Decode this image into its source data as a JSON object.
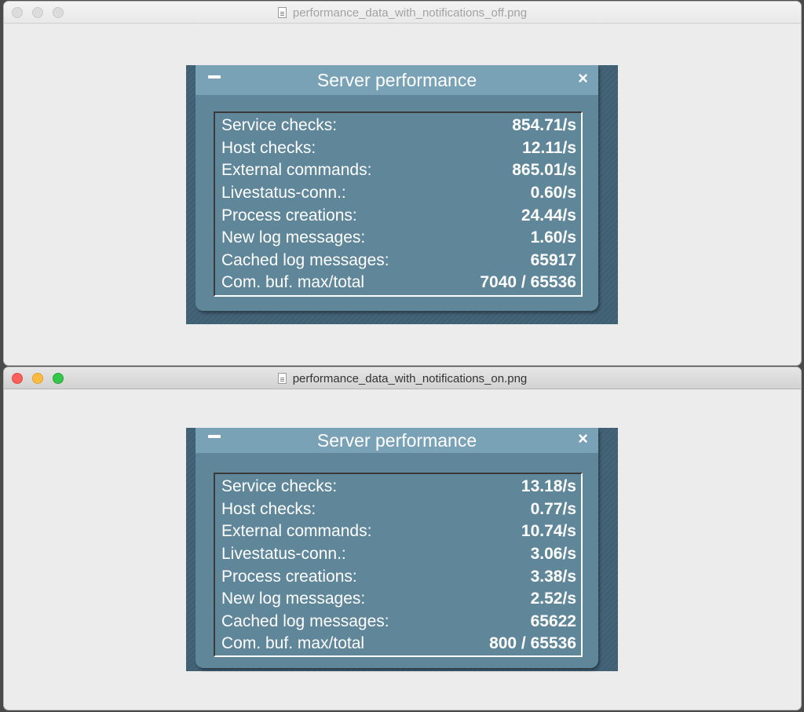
{
  "windows": [
    {
      "filename": "performance_data_with_notifications_off.png",
      "panel_title": "Server performance",
      "close_glyph": "×",
      "rows": [
        {
          "label": "Service checks:",
          "value": "854.71/s"
        },
        {
          "label": "Host checks:",
          "value": "12.11/s"
        },
        {
          "label": "External commands:",
          "value": "865.01/s"
        },
        {
          "label": "Livestatus-conn.:",
          "value": "0.60/s"
        },
        {
          "label": "Process creations:",
          "value": "24.44/s"
        },
        {
          "label": "New log messages:",
          "value": "1.60/s"
        },
        {
          "label": "Cached log messages:",
          "value": "65917"
        },
        {
          "label": "Com. buf. max/total",
          "value": "7040 / 65536"
        }
      ]
    },
    {
      "filename": "performance_data_with_notifications_on.png",
      "panel_title": "Server performance",
      "close_glyph": "×",
      "rows": [
        {
          "label": "Service checks:",
          "value": "13.18/s"
        },
        {
          "label": "Host checks:",
          "value": "0.77/s"
        },
        {
          "label": "External commands:",
          "value": "10.74/s"
        },
        {
          "label": "Livestatus-conn.:",
          "value": "3.06/s"
        },
        {
          "label": "Process creations:",
          "value": "3.38/s"
        },
        {
          "label": "New log messages:",
          "value": "2.52/s"
        },
        {
          "label": "Cached log messages:",
          "value": "65622"
        },
        {
          "label": "Com. buf. max/total",
          "value": "800 / 65536"
        }
      ]
    }
  ],
  "colors": {
    "panel_header": "#7aa2b6",
    "panel_body": "#5f8799",
    "background_texture": "#3f5f73",
    "close_red": "#fc605c",
    "minimize_yellow": "#fdbc40",
    "zoom_green": "#34c749"
  },
  "icons": [
    "close-window-icon",
    "minimize-window-icon",
    "zoom-window-icon",
    "image-file-icon",
    "minimize-panel-icon",
    "close-panel-icon"
  ]
}
